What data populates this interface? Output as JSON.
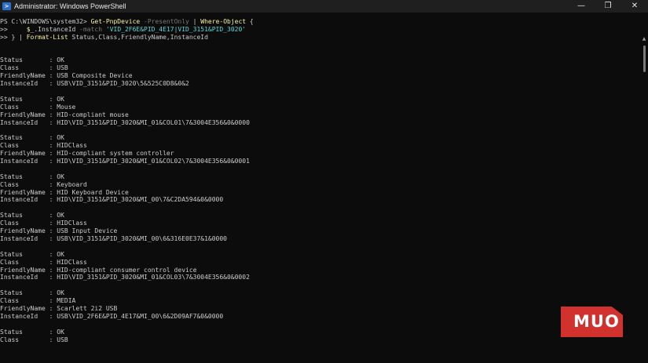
{
  "window": {
    "title": "Administrator: Windows PowerShell",
    "controls": {
      "minimize": "—",
      "maximize": "❐",
      "close": "✕"
    }
  },
  "command": {
    "prompt": "PS C:\\WINDOWS\\system32> ",
    "cmd1": "Get-PnpDevice",
    "param1": " -PresentOnly",
    "pipe1": " | ",
    "cmd2": "Where-Object",
    "brace_open": " {",
    "cont1_prompt": ">> ",
    "cont1_indent": "    ",
    "var": "$_",
    "prop": ".InstanceId",
    "param2": " -match",
    "string": " 'VID_2F6E&PID_4E17|VID_3151&PID_3020'",
    "cont2_prompt": ">> ",
    "cont2_text": "} | ",
    "cmd3": "Format-List",
    "args": " Status,Class,FriendlyName,InstanceId"
  },
  "devices": [
    {
      "status": "Status       : OK",
      "class": "Class        : USB",
      "friendly": "FriendlyName : USB Composite Device",
      "instance": "InstanceId   : USB\\VID_3151&PID_3020\\5&525C0D8&0&2"
    },
    {
      "status": "Status       : OK",
      "class": "Class        : Mouse",
      "friendly": "FriendlyName : HID-compliant mouse",
      "instance": "InstanceId   : HID\\VID_3151&PID_3020&MI_01&COL01\\7&3004E356&0&0000"
    },
    {
      "status": "Status       : OK",
      "class": "Class        : HIDClass",
      "friendly": "FriendlyName : HID-compliant system controller",
      "instance": "InstanceId   : HID\\VID_3151&PID_3020&MI_01&COL02\\7&3004E356&0&0001"
    },
    {
      "status": "Status       : OK",
      "class": "Class        : Keyboard",
      "friendly": "FriendlyName : HID Keyboard Device",
      "instance": "InstanceId   : HID\\VID_3151&PID_3020&MI_00\\7&C2DA594&0&0000"
    },
    {
      "status": "Status       : OK",
      "class": "Class        : HIDClass",
      "friendly": "FriendlyName : USB Input Device",
      "instance": "InstanceId   : USB\\VID_3151&PID_3020&MI_00\\6&316E0E37&1&0000"
    },
    {
      "status": "Status       : OK",
      "class": "Class        : HIDClass",
      "friendly": "FriendlyName : HID-compliant consumer control device",
      "instance": "InstanceId   : HID\\VID_3151&PID_3020&MI_01&COL03\\7&3004E356&0&0002"
    },
    {
      "status": "Status       : OK",
      "class": "Class        : MEDIA",
      "friendly": "FriendlyName : Scarlett 2i2 USB",
      "instance": "InstanceId   : USB\\VID_2F6E&PID_4E17&MI_00\\6&2D09AF7&0&0000"
    },
    {
      "status": "Status       : OK",
      "class": "Class        : USB"
    }
  ],
  "watermark": {
    "text": "MUO"
  },
  "colors": {
    "background": "#0c0c0c",
    "text": "#cccccc",
    "command": "#f9f1a5",
    "parameter": "#767676",
    "string": "#61d6d6",
    "logo": "#d2322d"
  }
}
